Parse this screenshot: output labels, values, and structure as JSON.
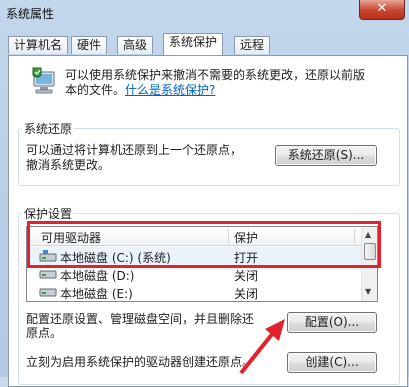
{
  "window": {
    "title": "系统属性",
    "close_label": "✕"
  },
  "tabs": [
    {
      "label": "计算机名",
      "active": false
    },
    {
      "label": "硬件",
      "active": false
    },
    {
      "label": "高级",
      "active": false
    },
    {
      "label": "系统保护",
      "active": true
    },
    {
      "label": "远程",
      "active": false
    }
  ],
  "intro": {
    "line1": "可以使用系统保护来撤消不需要的系统更改，还原以前版",
    "line2_prefix": "本的文件。",
    "link": "什么是系统保护?"
  },
  "restore": {
    "group_label": "系统还原",
    "desc_line1": "可以通过将计算机还原到上一个还原点，",
    "desc_line2": "撤消系统更改。",
    "button": "系统还原(S)..."
  },
  "protection": {
    "group_label": "保护设置",
    "columns": [
      "可用驱动器",
      "保护"
    ],
    "drives": [
      {
        "name": "本地磁盘 (C:) (系统)",
        "status": "打开",
        "selected": true
      },
      {
        "name": "本地磁盘 (D:)",
        "status": "关闭",
        "selected": false
      },
      {
        "name": "本地磁盘 (E:)",
        "status": "关闭",
        "selected": false
      }
    ]
  },
  "configure": {
    "desc_line1": "配置还原设置、管理磁盘空间，并且删除还",
    "desc_line2": "原点。",
    "button": "配置(O)..."
  },
  "create": {
    "desc": "立刻为启用系统保护的驱动器创建还原点。",
    "button": "创建(C)..."
  },
  "colors": {
    "annotation": "#e0232d",
    "link": "#0064c8"
  }
}
